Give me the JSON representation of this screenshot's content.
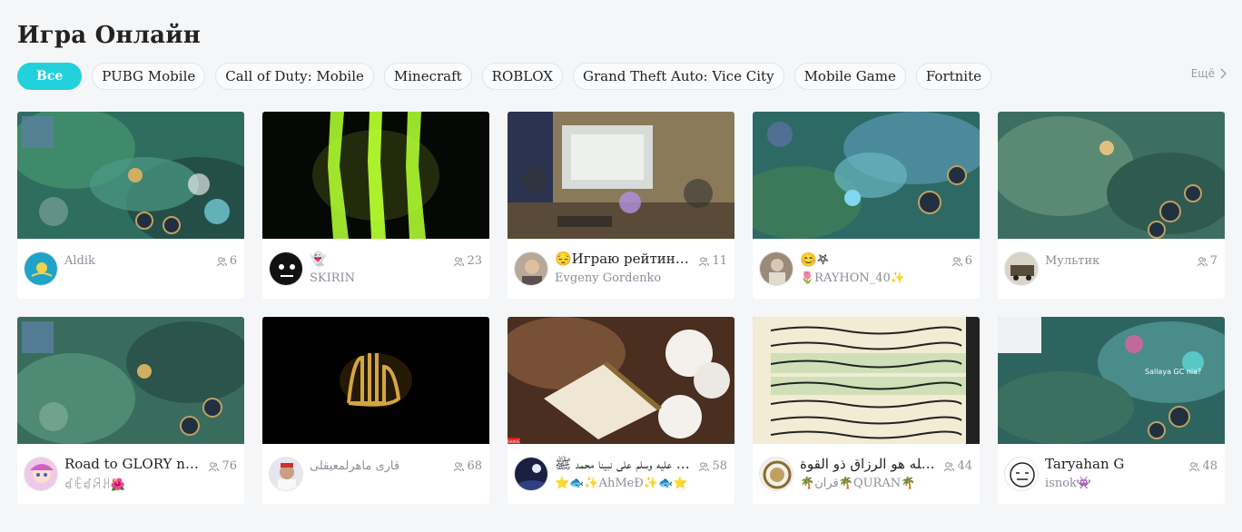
{
  "page": {
    "title": "Игра Онлайн"
  },
  "filters": {
    "chips": [
      {
        "label": "Все",
        "active": true
      },
      {
        "label": "PUBG Mobile",
        "active": false
      },
      {
        "label": "Call of Duty: Mobile",
        "active": false
      },
      {
        "label": "Minecraft",
        "active": false
      },
      {
        "label": "ROBLOX",
        "active": false
      },
      {
        "label": "Grand Theft Auto: Vice City",
        "active": false
      },
      {
        "label": "Mobile Game",
        "active": false
      },
      {
        "label": "Fortnite",
        "active": false
      }
    ],
    "more_label": "Ещё"
  },
  "colors": {
    "accent": "#22d1dc",
    "muted_text": "#8a8f97",
    "card_bg": "#ffffff",
    "page_bg": "#f5f6f8"
  },
  "streams": [
    {
      "title": "",
      "streamer": "Aldik",
      "viewers": "6",
      "thumb": "moba",
      "avatar": "flag-kz"
    },
    {
      "title": "👻",
      "streamer": "SKIRIN",
      "viewers": "23",
      "thumb": "monster",
      "avatar": "skull"
    },
    {
      "title": "😔Играю рейтин…",
      "streamer": "Evgeny Gordenko",
      "viewers": "11",
      "thumb": "room",
      "avatar": "face"
    },
    {
      "title": "😊𖤐",
      "streamer": "🌷RAYHON_40✨",
      "viewers": "6",
      "thumb": "moba",
      "avatar": "portrait"
    },
    {
      "title": "",
      "streamer": "Мультик",
      "viewers": "7",
      "thumb": "moba2",
      "avatar": "truck"
    },
    {
      "title": "Road to GLORY n…",
      "streamer": "ꀸꍟꀸꋪꃅ🌺",
      "viewers": "76",
      "thumb": "moba2",
      "avatar": "anime"
    },
    {
      "title": "",
      "streamer": "قارى ماهرلمعيقلى",
      "viewers": "68",
      "thumb": "calligraphy",
      "avatar": "man"
    },
    {
      "title": "صلى الله عليه وسلم على نبينا محمد ﷺ…",
      "streamer": "⭐🐟✨AhMeÐ✨🐟⭐",
      "viewers": "58",
      "thumb": "quran-flowers",
      "avatar": "night"
    },
    {
      "title": "إن الله هو الرزاق ذو القوة",
      "streamer": "🌴قرآن🌴QURAN🌴",
      "viewers": "44",
      "thumb": "quran-page",
      "avatar": "emblem"
    },
    {
      "title": "Taryahan G",
      "streamer": "isnok👾",
      "viewers": "48",
      "thumb": "moba3",
      "avatar": "meme"
    }
  ],
  "thumb_overlays": {
    "card_9_text": "Sallaya GC nia?",
    "card_7_badge": "SHARE"
  },
  "icons": {
    "viewer": "people-icon",
    "more": "chevron-right-icon"
  }
}
